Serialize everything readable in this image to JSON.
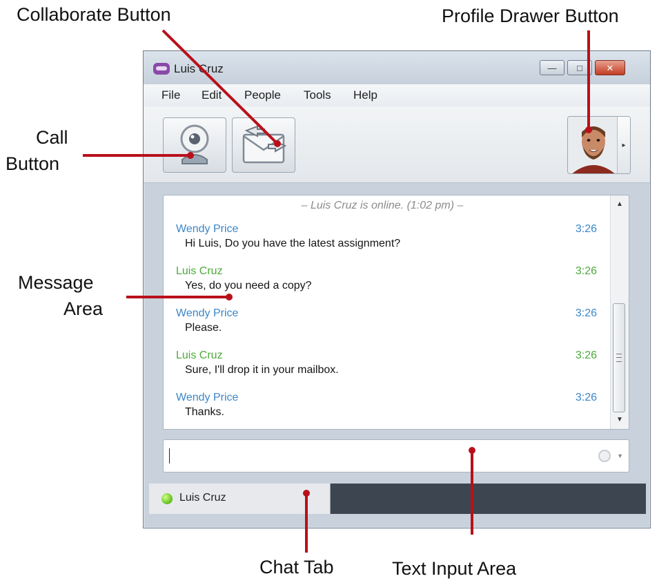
{
  "callouts": {
    "collaborate": "Collaborate Button",
    "profile_drawer": "Profile Drawer Button",
    "call_line1": "Call",
    "call_line2": "Button",
    "message_line1": "Message",
    "message_line2": "Area",
    "chat_tab": "Chat Tab",
    "text_input": "Text Input Area"
  },
  "window": {
    "title": "Luis Cruz",
    "controls": {
      "minimize": "—",
      "maximize": "□",
      "close": "✕"
    }
  },
  "menu": [
    "File",
    "Edit",
    "People",
    "Tools",
    "Help"
  ],
  "toolbar": {
    "call_icon": "webcam-icon",
    "collaborate_icon": "collaborate-icon",
    "profile_icon": "profile-photo"
  },
  "chat": {
    "online_status": "– Luis Cruz is online. (1:02 pm) –",
    "messages": [
      {
        "sender": "Wendy Price",
        "time": "3:26",
        "text": "Hi Luis, Do you have the latest assignment?",
        "color": "#3a86c8"
      },
      {
        "sender": "Luis Cruz",
        "time": "3:26",
        "text": "Yes, do you need a copy?",
        "color": "#4caa3a"
      },
      {
        "sender": "Wendy Price",
        "time": "3:26",
        "text": "Please.",
        "color": "#3a86c8"
      },
      {
        "sender": "Luis Cruz",
        "time": "3:26",
        "text": "Sure, I'll drop it in your mailbox.",
        "color": "#4caa3a"
      },
      {
        "sender": "Wendy Price",
        "time": "3:26",
        "text": "Thanks.",
        "color": "#3a86c8"
      }
    ]
  },
  "input": {
    "value": ""
  },
  "tab": {
    "label": "Luis Cruz"
  },
  "colors": {
    "callout_line": "#b8101a",
    "status_online": "#5ebd1a"
  }
}
